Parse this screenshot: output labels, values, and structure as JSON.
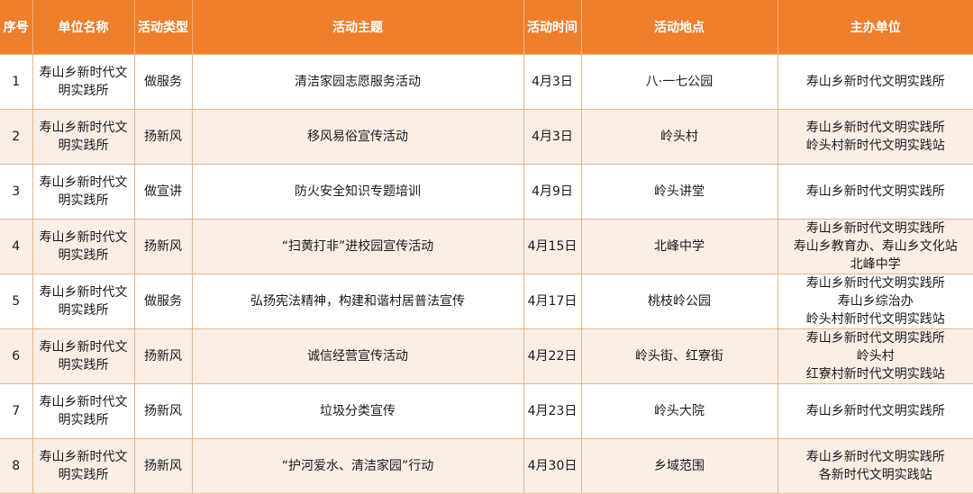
{
  "headers": [
    "序号",
    "单位名称",
    "活动类型",
    "活动主题",
    "活动时间",
    "活动地点",
    "主办单位"
  ],
  "rows": [
    {
      "no": "1",
      "unit": [
        "寿山乡新时代文",
        "明实践所"
      ],
      "type": "做服务",
      "theme": "清洁家园志愿服务活动",
      "time": "4月3日",
      "place": "八·一七公园",
      "host": [
        "寿山乡新时代文明实践所"
      ]
    },
    {
      "no": "2",
      "unit": [
        "寿山乡新时代文",
        "明实践所"
      ],
      "type": "扬新风",
      "theme": "移风易俗宣传活动",
      "time": "4月3日",
      "place": "岭头村",
      "host": [
        "寿山乡新时代文明实践所",
        "岭头村新时代文明实践站"
      ]
    },
    {
      "no": "3",
      "unit": [
        "寿山乡新时代文",
        "明实践所"
      ],
      "type": "做宣讲",
      "theme": "防火安全知识专题培训",
      "time": "4月9日",
      "place": "岭头讲堂",
      "host": [
        "寿山乡新时代文明实践所"
      ]
    },
    {
      "no": "4",
      "unit": [
        "寿山乡新时代文",
        "明实践所"
      ],
      "type": "扬新风",
      "theme": "“扫黄打非”进校园宣传活动",
      "time": "4月15日",
      "place": "北峰中学",
      "host": [
        "寿山乡新时代文明实践所",
        "寿山乡教育办、寿山乡文化站",
        "北峰中学"
      ]
    },
    {
      "no": "5",
      "unit": [
        "寿山乡新时代文",
        "明实践所"
      ],
      "type": "做服务",
      "theme": "弘扬宪法精神，构建和谐村居普法宣传",
      "time": "4月17日",
      "place": "桃枝岭公园",
      "host": [
        "寿山乡新时代文明实践所",
        "寿山乡综治办",
        "岭头村新时代文明实践站"
      ]
    },
    {
      "no": "6",
      "unit": [
        "寿山乡新时代文",
        "明实践所"
      ],
      "type": "扬新风",
      "theme": "诚信经营宣传活动",
      "time": "4月22日",
      "place": "岭头街、红寮街",
      "host": [
        "寿山乡新时代文明实践所",
        "岭头村",
        "红寮村新时代文明实践站"
      ]
    },
    {
      "no": "7",
      "unit": [
        "寿山乡新时代文",
        "明实践所"
      ],
      "type": "扬新风",
      "theme": "垃圾分类宣传",
      "time": "4月23日",
      "place": "岭头大院",
      "host": [
        "寿山乡新时代文明实践所"
      ]
    },
    {
      "no": "8",
      "unit": [
        "寿山乡新时代文",
        "明实践所"
      ],
      "type": "扬新风",
      "theme": "“护河爱水、清洁家园”行动",
      "time": "4月30日",
      "place": "乡域范围",
      "host": [
        "寿山乡新时代文明实践所",
        "各新时代文明实践站"
      ]
    }
  ]
}
